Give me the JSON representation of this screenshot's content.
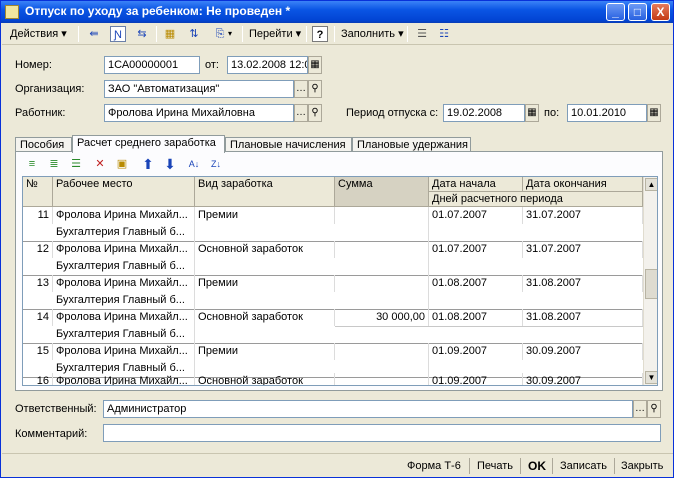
{
  "window": {
    "title": "Отпуск по уходу за ребенком: Не проведен *",
    "minimize": "_",
    "maximize": "□",
    "close": "X"
  },
  "toolbar": {
    "actions_label": "Действия",
    "goto_label": "Перейти",
    "help_label": "?",
    "fill_label": "Заполнить"
  },
  "form": {
    "number_label": "Номер:",
    "number_value": "1СА00000001",
    "from_label": "от:",
    "date_value": "13.02.2008 12:0",
    "org_label": "Организация:",
    "org_value": "ЗАО \"Автоматизация\"",
    "employee_label": "Работник:",
    "employee_value": "Фролова Ирина Михайловна",
    "period_label": "Период отпуска с:",
    "period_from": "19.02.2008",
    "period_to_label": "по:",
    "period_to": "10.01.2010"
  },
  "tabs": [
    "Пособия",
    "Расчет среднего заработка",
    "Плановые начисления",
    "Плановые удержания"
  ],
  "grid": {
    "headers": {
      "num": "№",
      "workplace": "Рабочее место",
      "earning_type": "Вид заработка",
      "sum": "Сумма",
      "date_start": "Дата начала",
      "date_end": "Дата окончания",
      "days": "Дней расчетного периода"
    },
    "rows": [
      {
        "num": "11",
        "name": "Фролова Ирина Михайл...",
        "dept": "Бухгалтерия  Главный б...",
        "type": "Премии",
        "sum": "",
        "start": "01.07.2007",
        "end": "31.07.2007"
      },
      {
        "num": "12",
        "name": "Фролова Ирина Михайл...",
        "dept": "Бухгалтерия  Главный б...",
        "type": "Основной заработок",
        "sum": "",
        "start": "01.07.2007",
        "end": "31.07.2007"
      },
      {
        "num": "13",
        "name": "Фролова Ирина Михайл...",
        "dept": "Бухгалтерия  Главный б...",
        "type": "Премии",
        "sum": "",
        "start": "01.08.2007",
        "end": "31.08.2007"
      },
      {
        "num": "14",
        "name": "Фролова Ирина Михайл...",
        "dept": "Бухгалтерия  Главный б...",
        "type": "Основной заработок",
        "sum": "30 000,00",
        "start": "01.08.2007",
        "end": "31.08.2007"
      },
      {
        "num": "15",
        "name": "Фролова Ирина Михайл...",
        "dept": "Бухгалтерия  Главный б...",
        "type": "Премии",
        "sum": "",
        "start": "01.09.2007",
        "end": "30.09.2007"
      },
      {
        "num": "16",
        "name": "Фролова Ирина Михайл...",
        "dept": "",
        "type": "Основной заработок",
        "sum": "",
        "start": "01.09.2007",
        "end": "30.09.2007"
      }
    ]
  },
  "footer": {
    "responsible_label": "Ответственный:",
    "responsible_value": "Администратор",
    "comment_label": "Комментарий:",
    "comment_value": ""
  },
  "buttons": {
    "form_t6": "Форма Т-6",
    "print": "Печать",
    "ok": "OK",
    "save": "Записать",
    "close": "Закрыть"
  },
  "icons": [
    "document-icon",
    "back-arrow-icon",
    "post-icon",
    "refresh-icon",
    "subordinate-icon",
    "move-icon",
    "copy-icon",
    "help-icon",
    "columns-icon",
    "list-icon",
    "add-row-icon",
    "insert-row-icon",
    "copy-row-icon",
    "delete-row-icon",
    "ok-row-icon",
    "arrow-up-icon",
    "arrow-down-icon",
    "sort-asc-icon",
    "sort-desc-icon",
    "select-icon",
    "search-icon",
    "calendar-icon"
  ]
}
